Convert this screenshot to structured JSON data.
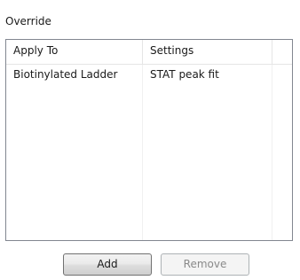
{
  "override": {
    "group_label": "Override",
    "columns": [
      "Apply To",
      "Settings"
    ],
    "rows": [
      {
        "apply_to": "Biotinylated Ladder",
        "settings": "STAT peak fit"
      }
    ],
    "buttons": {
      "add_label": "Add",
      "remove_label": "Remove"
    }
  }
}
